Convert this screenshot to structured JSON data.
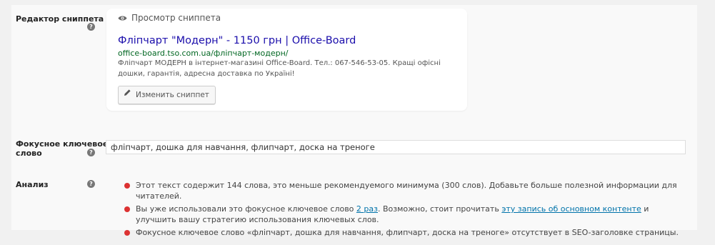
{
  "colors": {
    "bad": "#dc3232",
    "link": "#0073aa",
    "snippet_title": "#1a0dab",
    "snippet_url": "#006621"
  },
  "snippet_editor": {
    "label": "Редактор сниппета",
    "preview_heading": "Просмотр сниппета",
    "preview_icon": "eye-icon",
    "title": "Фліпчарт \"Модерн\" - 1150 грн | Office-Board",
    "url": "office-board.tso.com.ua/фліпчарт-модерн/",
    "description": "Фліпчарт МОДЕРН в інтернет-магазині Office-Board. Тел.: 067-546-53-05. Кращі офісні дошки, гарантія, адресна доставка по Україні!",
    "edit_button": "Изменить сниппет",
    "edit_icon": "pencil-icon"
  },
  "focus_keyword": {
    "label_line1": "Фокусное ключевое",
    "label_line2": "слово",
    "value": "фліпчарт, дошка для навчання, флипчарт, доска на треноге"
  },
  "analysis": {
    "label": "Анализ",
    "items": [
      {
        "status": "bad",
        "text": "Этот текст содержит 144 слова, это меньше рекомендуемого минимума (300 слов). Добавьте больше полезной информации для читателей."
      },
      {
        "status": "bad",
        "text_before": "Вы уже использовали это фокусное ключевое слово ",
        "link1": "2 раз",
        "text_middle": ". Возможно, стоит прочитать ",
        "link2": "эту запись об основном контенте",
        "text_after": " и улучшить вашу стратегию использования ключевых слов."
      },
      {
        "status": "bad",
        "text": "Фокусное ключевое слово «фліпчарт, дошка для навчання, флипчарт, доска на треноге» отсутствует в SEO-заголовке страницы."
      }
    ]
  },
  "help_icon": "question-icon",
  "help_glyph": "?"
}
